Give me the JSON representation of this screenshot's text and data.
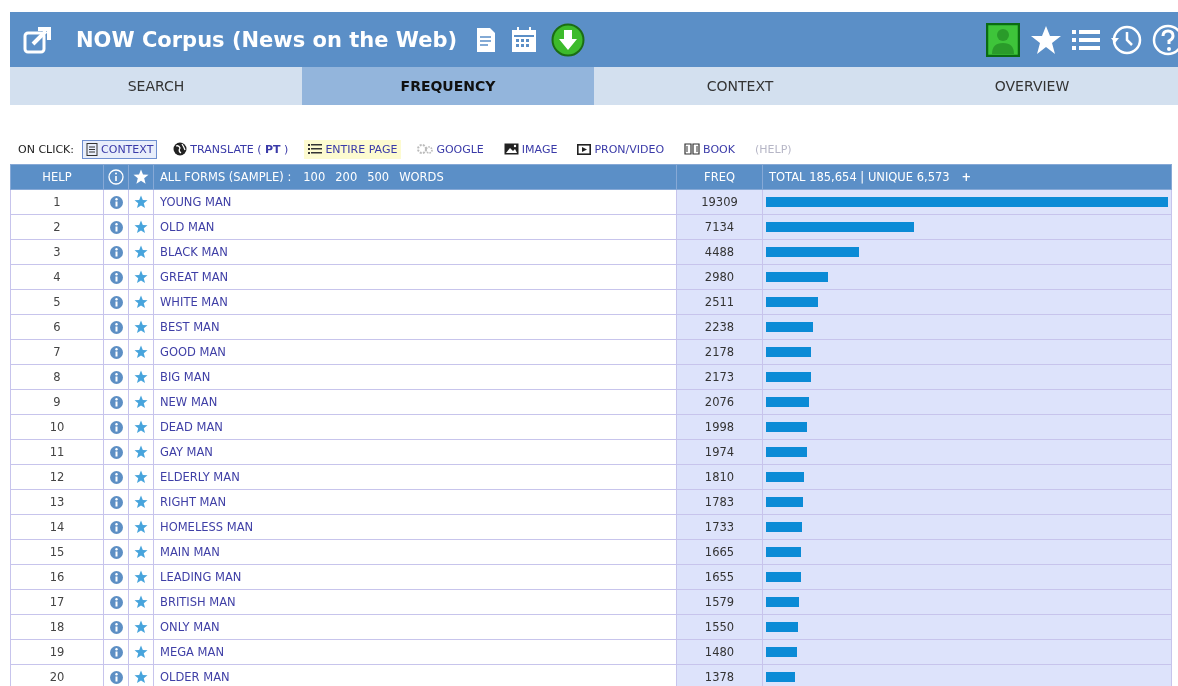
{
  "header": {
    "title": "NOW Corpus (News on the Web)"
  },
  "tabs": [
    {
      "label": "SEARCH",
      "selected": false
    },
    {
      "label": "FREQUENCY",
      "selected": true
    },
    {
      "label": "CONTEXT",
      "selected": false
    },
    {
      "label": "OVERVIEW",
      "selected": false
    }
  ],
  "on_click": {
    "label": "ON CLICK:",
    "options": [
      {
        "label": "CONTEXT",
        "selected": true,
        "highlighted": false,
        "disabled": false
      },
      {
        "label": "TRANSLATE  ( **PT** )",
        "selected": false,
        "highlighted": false,
        "disabled": false
      },
      {
        "label": "ENTIRE PAGE",
        "selected": false,
        "highlighted": true,
        "disabled": false
      },
      {
        "label": "GOOGLE",
        "selected": false,
        "highlighted": false,
        "disabled": false
      },
      {
        "label": "IMAGE",
        "selected": false,
        "highlighted": false,
        "disabled": false
      },
      {
        "label": "PRON/VIDEO",
        "selected": false,
        "highlighted": false,
        "disabled": false
      },
      {
        "label": "BOOK",
        "selected": false,
        "highlighted": false,
        "disabled": false
      },
      {
        "label": "(HELP)",
        "selected": false,
        "highlighted": false,
        "disabled": true
      }
    ]
  },
  "table": {
    "columns": {
      "help": "HELP",
      "forms_label": "ALL FORMS  (SAMPLE) :",
      "sample_sizes": [
        "100",
        "200",
        "500"
      ],
      "words": "WORDS",
      "freq": "FREQ",
      "totals": "TOTAL 185,654  |  UNIQUE 6,573",
      "more": "+"
    },
    "rows": [
      {
        "rank": "1",
        "word": "YOUNG MAN",
        "freq": "19309",
        "level": 1.0
      },
      {
        "rank": "2",
        "word": "OLD MAN",
        "freq": "7134",
        "level": 0.369
      },
      {
        "rank": "3",
        "word": "BLACK MAN",
        "freq": "4488",
        "level": 0.232
      },
      {
        "rank": "4",
        "word": "GREAT MAN",
        "freq": "2980",
        "level": 0.154
      },
      {
        "rank": "5",
        "word": "WHITE MAN",
        "freq": "2511",
        "level": 0.13
      },
      {
        "rank": "6",
        "word": "BEST MAN",
        "freq": "2238",
        "level": 0.116
      },
      {
        "rank": "7",
        "word": "GOOD MAN",
        "freq": "2178",
        "level": 0.113
      },
      {
        "rank": "8",
        "word": "BIG MAN",
        "freq": "2173",
        "level": 0.113
      },
      {
        "rank": "9",
        "word": "NEW MAN",
        "freq": "2076",
        "level": 0.108
      },
      {
        "rank": "10",
        "word": "DEAD MAN",
        "freq": "1998",
        "level": 0.103
      },
      {
        "rank": "11",
        "word": "GAY MAN",
        "freq": "1974",
        "level": 0.102
      },
      {
        "rank": "12",
        "word": "ELDERLY MAN",
        "freq": "1810",
        "level": 0.094
      },
      {
        "rank": "13",
        "word": "RIGHT MAN",
        "freq": "1783",
        "level": 0.092
      },
      {
        "rank": "14",
        "word": "HOMELESS MAN",
        "freq": "1733",
        "level": 0.09
      },
      {
        "rank": "15",
        "word": "MAIN MAN",
        "freq": "1665",
        "level": 0.086
      },
      {
        "rank": "16",
        "word": "LEADING MAN",
        "freq": "1655",
        "level": 0.086
      },
      {
        "rank": "17",
        "word": "BRITISH MAN",
        "freq": "1579",
        "level": 0.082
      },
      {
        "rank": "18",
        "word": "ONLY MAN",
        "freq": "1550",
        "level": 0.08
      },
      {
        "rank": "19",
        "word": "MEGA MAN",
        "freq": "1480",
        "level": 0.077
      },
      {
        "rank": "20",
        "word": "OLDER MAN",
        "freq": "1378",
        "level": 0.071
      }
    ]
  }
}
